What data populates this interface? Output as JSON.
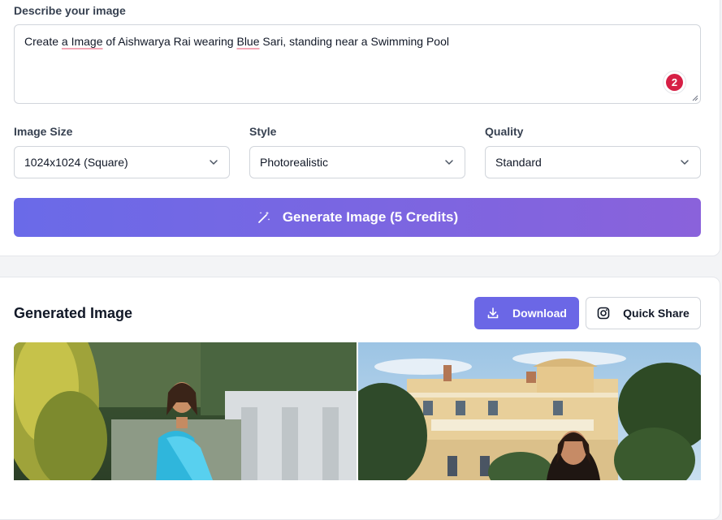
{
  "prompt": {
    "label": "Describe your image",
    "parts": [
      "Create ",
      "a Image",
      " of Aishwarya Rai wearing ",
      "Blue",
      " Sari, standing near a Swimming Pool"
    ],
    "badge_count": "2"
  },
  "options": {
    "size": {
      "label": "Image Size",
      "value": "1024x1024 (Square)"
    },
    "style": {
      "label": "Style",
      "value": "Photorealistic"
    },
    "quality": {
      "label": "Quality",
      "value": "Standard"
    }
  },
  "generate_button": {
    "label": "Generate Image (5 Credits)"
  },
  "result": {
    "title": "Generated Image",
    "download_label": "Download",
    "share_label": "Quick Share"
  },
  "colors": {
    "accent": "#6b67e6",
    "badge": "#d61f45"
  },
  "icons": [
    "magic-wand-icon",
    "download-icon",
    "instagram-icon",
    "chevron-down-icon"
  ]
}
